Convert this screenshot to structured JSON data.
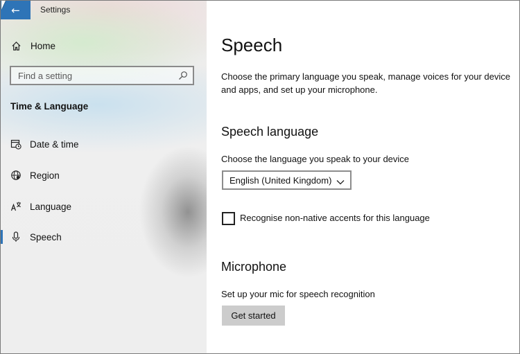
{
  "window": {
    "title": "Settings"
  },
  "sidebar": {
    "home_label": "Home",
    "search": {
      "placeholder": "Find a setting"
    },
    "section_heading": "Time & Language",
    "items": [
      {
        "label": "Date & time",
        "icon": "calendar-clock-icon"
      },
      {
        "label": "Region",
        "icon": "globe-icon"
      },
      {
        "label": "Language",
        "icon": "language-icon"
      },
      {
        "label": "Speech",
        "icon": "microphone-icon",
        "selected": true
      }
    ]
  },
  "main": {
    "page_title": "Speech",
    "description": "Choose the primary language you speak, manage voices for your device and apps, and set up your microphone.",
    "speech_language": {
      "heading": "Speech language",
      "prompt": "Choose the language you speak to your device",
      "selected_language": "English (United Kingdom)",
      "checkbox_label": "Recognise non-native accents for this language",
      "checkbox_checked": false
    },
    "microphone": {
      "heading": "Microphone",
      "prompt": "Set up your mic for speech recognition",
      "button_label": "Get started"
    }
  },
  "colors": {
    "accent": "#2e74b7",
    "button_bg": "#cccccc"
  }
}
